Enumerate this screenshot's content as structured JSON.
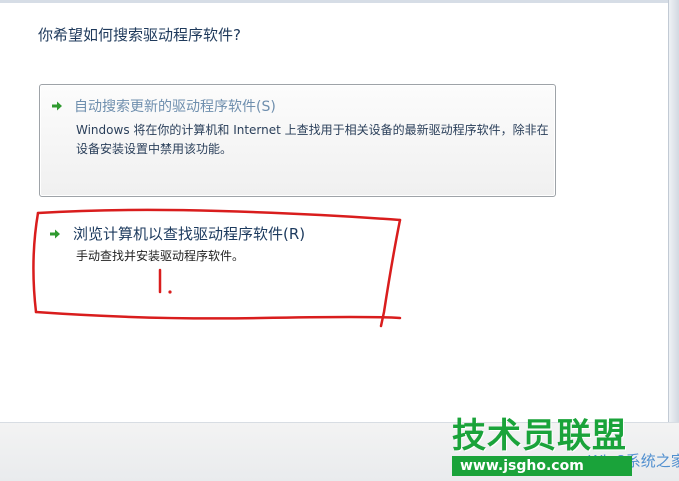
{
  "dialog": {
    "title": "你希望如何搜索驱动程序软件?"
  },
  "options": [
    {
      "title": "自动搜索更新的驱动程序软件(S)",
      "description": "Windows 将在你的计算机和 Internet 上查找用于相关设备的最新驱动程序软件，除非在设备安装设置中禁用该功能。",
      "enabled": false
    },
    {
      "title": "浏览计算机以查找驱动程序软件(R)",
      "description": "手动查找并安装驱动程序软件。",
      "enabled": true
    }
  ],
  "annotation": {
    "label": "1.",
    "color": "#d91d1d"
  },
  "watermark": {
    "main": "技术员联盟",
    "url": "www.jsgho.com",
    "ghost": "Win8系统之家",
    "color": "#1aa33a"
  },
  "colors": {
    "title": "#1e395b",
    "link": "#1c3a5e",
    "disabled_link": "#6f8fae",
    "arrow": "#2f9a2f"
  }
}
